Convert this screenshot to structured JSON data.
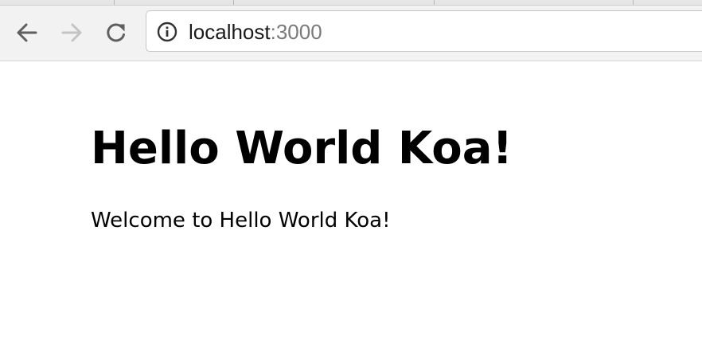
{
  "browser": {
    "address_bar": {
      "host": "localhost",
      "port": ":3000",
      "icon": "info-icon"
    },
    "nav": {
      "back_icon": "arrow-left-icon",
      "forward_icon": "arrow-right-icon",
      "reload_icon": "reload-icon",
      "forward_enabled": false
    },
    "colors": {
      "toolbar_bg": "#f2f2f2",
      "icon_active": "#5f5f5f",
      "icon_disabled": "#c4c4c4",
      "url_port": "#7a7a7a"
    }
  },
  "page": {
    "heading": "Hello World Koa!",
    "paragraph": "Welcome to Hello World Koa!"
  }
}
